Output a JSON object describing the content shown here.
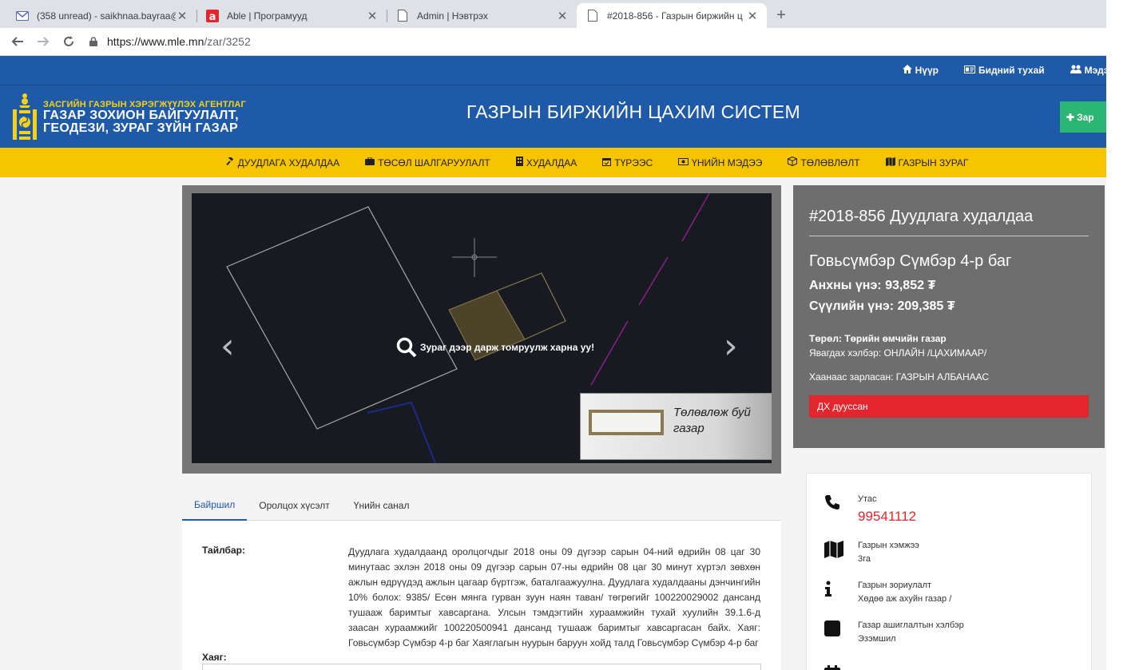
{
  "browser": {
    "tabs": [
      {
        "title": "(358 unread) - saikhnaa.bayraa@",
        "icon": "mail-icon"
      },
      {
        "title": "Able  |  Програмууд",
        "icon": "able-icon"
      },
      {
        "title": "Admin | Нэвтрэх",
        "icon": "page-icon"
      },
      {
        "title": "#2018-856 - Газрын биржийн ц",
        "icon": "page-icon"
      }
    ],
    "url_host": "https://www.mle.mn",
    "url_path": "/zar/3252",
    "new_tab": "+",
    "close_glyph": "✕"
  },
  "topnav": {
    "items": [
      {
        "label": "Нүүр",
        "icon": "home-icon"
      },
      {
        "label": "Бидний тухай",
        "icon": "card-icon"
      },
      {
        "label": "Мэдээ",
        "icon": "users-icon"
      }
    ]
  },
  "header": {
    "agency_line1": "ЗАСГИЙН ГАЗРЫН ХЭРЭГЖҮҮЛЭХ АГЕНТЛАГ",
    "agency_line2": "ГАЗАР ЗОХИОН БАЙГУУЛАЛТ,",
    "agency_line3": "ГЕОДЕЗИ, ЗУРАГ ЗҮЙН ГАЗАР",
    "system_title": "ГАЗРЫН БИРЖИЙН ЦАХИМ СИСТЕМ",
    "add_button": "Зар",
    "colors": {
      "primary": "#1e5aa8",
      "yellow": "#f6c400",
      "green": "#2bb673",
      "red": "#e3262d"
    }
  },
  "menu": {
    "items": [
      {
        "label": "ДУУДЛАГА ХУДАЛДАА",
        "icon": "gavel-icon"
      },
      {
        "label": "ТӨСӨЛ ШАЛГАРУУЛАЛТ",
        "icon": "briefcase-icon"
      },
      {
        "label": "ХУДАЛДАА",
        "icon": "building-icon"
      },
      {
        "label": "ТҮРЭЭС",
        "icon": "calendar-icon"
      },
      {
        "label": "ҮНИЙН МЭДЭЭ",
        "icon": "money-icon"
      },
      {
        "label": "ТӨЛӨВЛӨЛТ",
        "icon": "cube-icon"
      },
      {
        "label": "ГАЗРЫН ЗУРАГ",
        "icon": "map-icon"
      }
    ]
  },
  "slider": {
    "zoom_hint": "Зураг дээр дарж томруулж харна уу!",
    "legend_label": "Төлөвлөж буй газар",
    "prev": "‹",
    "next": "›"
  },
  "info": {
    "number_title": "#2018-856 Дуудлага худалдаа",
    "location": "Говьсүмбэр Сүмбэр 4-р баг",
    "start_price": "Анхны үнэ: 93,852 ₮",
    "last_price": "Сүүлийн үнэ: 209,385 ₮",
    "type": "Төрөл: Төрийн өмчийн газар",
    "mode": "Явагдах хэлбэр: ОНЛАЙН /ЦАХИМААР/",
    "announcer": "Хаанаас зарласан: ГАЗРЫН АЛБАНААС",
    "status": "ДХ дууссан"
  },
  "tabs": {
    "items": [
      "Байршил",
      "Оролцох хүсэлт",
      "Үнийн санал"
    ],
    "active": 0
  },
  "details": {
    "desc_label": "Тайлбар:",
    "desc_text": "Дуудлага худалдаанд оролцогчдыг 2018 оны 09 дүгээр сарын 04-ний өдрийн 08 цаг 30 минутаас эхлэн 2018 оны 09 дүгээр сарын 07-ны өдрийн 08 цаг 30 минут хүртэл зөвхөн ажлын өдрүүдэд ажлын цагаар бүртгэж, баталгаажуулна. Дуудлага худалдааны дэнчингийн 10% болох: 9385/ Есөн мянга гурван зуун наян таван/ төгрөгийг 100220029002 дансанд тушааж баримтыг хавсаргана. Улсын тэмдэгтийн хураамжийн тухай хуулийн 39.1.6-д заасан хураамжийг 100220500941 дансанд тушааж баримтыг хавсаргасан байх. Хаяг: Говьсүмбэр Сүмбэр 4-р баг Хаяглагын нуурын баруун хойд талд Говьсүмбэр Сүмбэр 4-р баг",
    "address_label": "Хаяг:"
  },
  "contact": {
    "phone_label": "Утас",
    "phone_value": "99541112",
    "size_label": "Газрын хэмжээ",
    "size_value": "3га",
    "purpose_label": "Газрын зориулалт",
    "purpose_value": "Хөдөө аж ахуйн газар /",
    "usage_label": "Газар ашиглалтын хэлбэр",
    "usage_value": "Эзэмшил"
  }
}
